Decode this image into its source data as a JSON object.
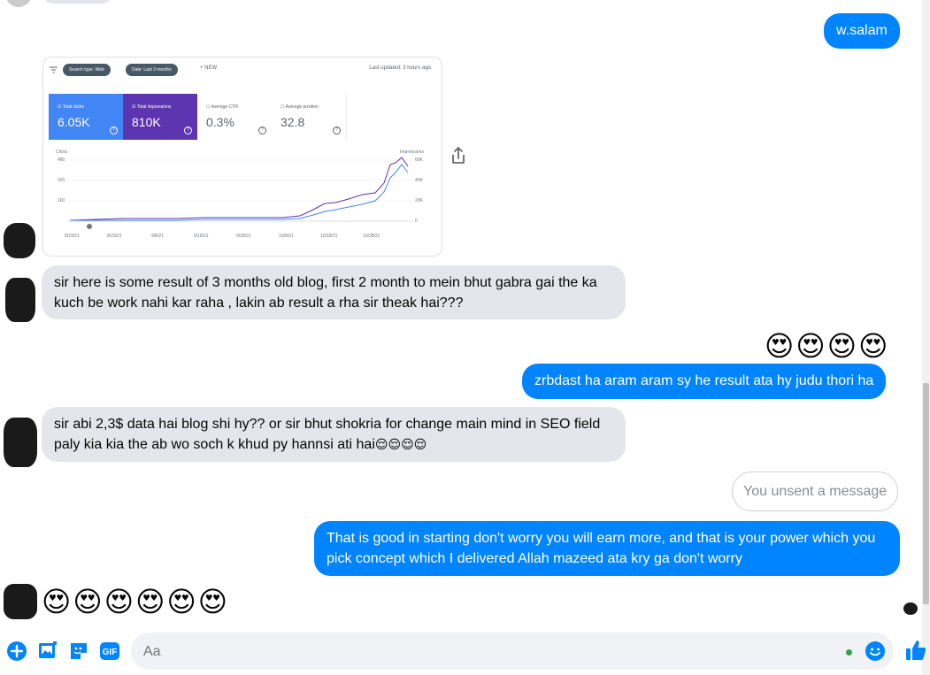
{
  "messages": {
    "out_1": "w.salam",
    "in_1": "sir here is some result of 3 months old blog, first 2 month to mein bhut gabra gai the ka kuch be work nahi kar raha , lakin ab result a rha sir theak hai???",
    "emoji_reaction_1": "😍😍😍😍",
    "out_2": "zrbdast ha aram aram sy he result ata hy judu thori ha",
    "in_2_text": "sir abi 2,3$ data hai blog shi hy?? or sir bhut shokria for change main mind in SEO field paly kia kia the ab wo soch k khud py hannsi ati hai",
    "in_2_emoji": "😌😌😌😌",
    "unsent": "You unsent a message",
    "out_3": "That is good in starting don't worry you will earn more, and that is your power which you pick concept which I delivered Allah mazeed ata kry ga don't worry",
    "emoji_reaction_2": "😍😍😍😍😍😍"
  },
  "screenshot_card": {
    "filter_chip_1": "Search type: Web",
    "filter_chip_2": "Date: Last 3 months",
    "new_label": "+  NEW",
    "last_updated": "Last updated: 3 hours ago",
    "metrics": [
      {
        "label": "Total clicks",
        "value": "6.05K"
      },
      {
        "label": "Total impressions",
        "value": "810K"
      },
      {
        "label": "Average CTR",
        "value": "0.3%"
      },
      {
        "label": "Average position",
        "value": "32.8"
      }
    ],
    "left_axis_title": "Clicks",
    "right_axis_title": "Impressions",
    "left_ticks": [
      "480",
      "320",
      "160"
    ],
    "right_ticks": [
      "60K",
      "40K",
      "20K",
      "0"
    ],
    "dates": [
      "8/19/21",
      "8/29/21",
      "9/8/21",
      "9/18/21",
      "9/28/21",
      "10/8/21",
      "10/18/21",
      "10/28/21"
    ],
    "colors": {
      "clicks": "#4285f4",
      "impressions": "#5e35b1"
    }
  },
  "composer": {
    "placeholder": "Aa"
  },
  "colors": {
    "accent": "#0084ff",
    "incoming_bubble": "#e4e6eb"
  }
}
